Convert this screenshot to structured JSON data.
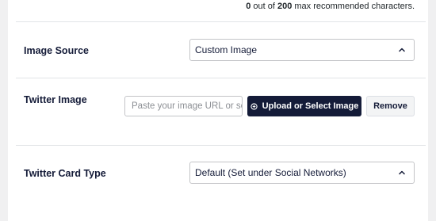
{
  "char_counter": {
    "current": "0",
    "mid_text": " out of ",
    "max": "200",
    "suffix": " max recommended characters."
  },
  "image_source": {
    "label": "Image Source",
    "value": "Custom Image"
  },
  "twitter_image": {
    "label": "Twitter Image",
    "input_placeholder": "Paste your image URL or se",
    "upload_button": "Upload or Select Image",
    "remove_button": "Remove"
  },
  "twitter_card_type": {
    "label": "Twitter Card Type",
    "value": "Default (Set under Social Networks)"
  },
  "icons": {
    "select_chevron": "chevron-up-icon",
    "upload": "plus-circle-icon"
  },
  "colors": {
    "primary_button": "#141b38",
    "background": "#f0f0f1",
    "panel": "#ffffff"
  }
}
